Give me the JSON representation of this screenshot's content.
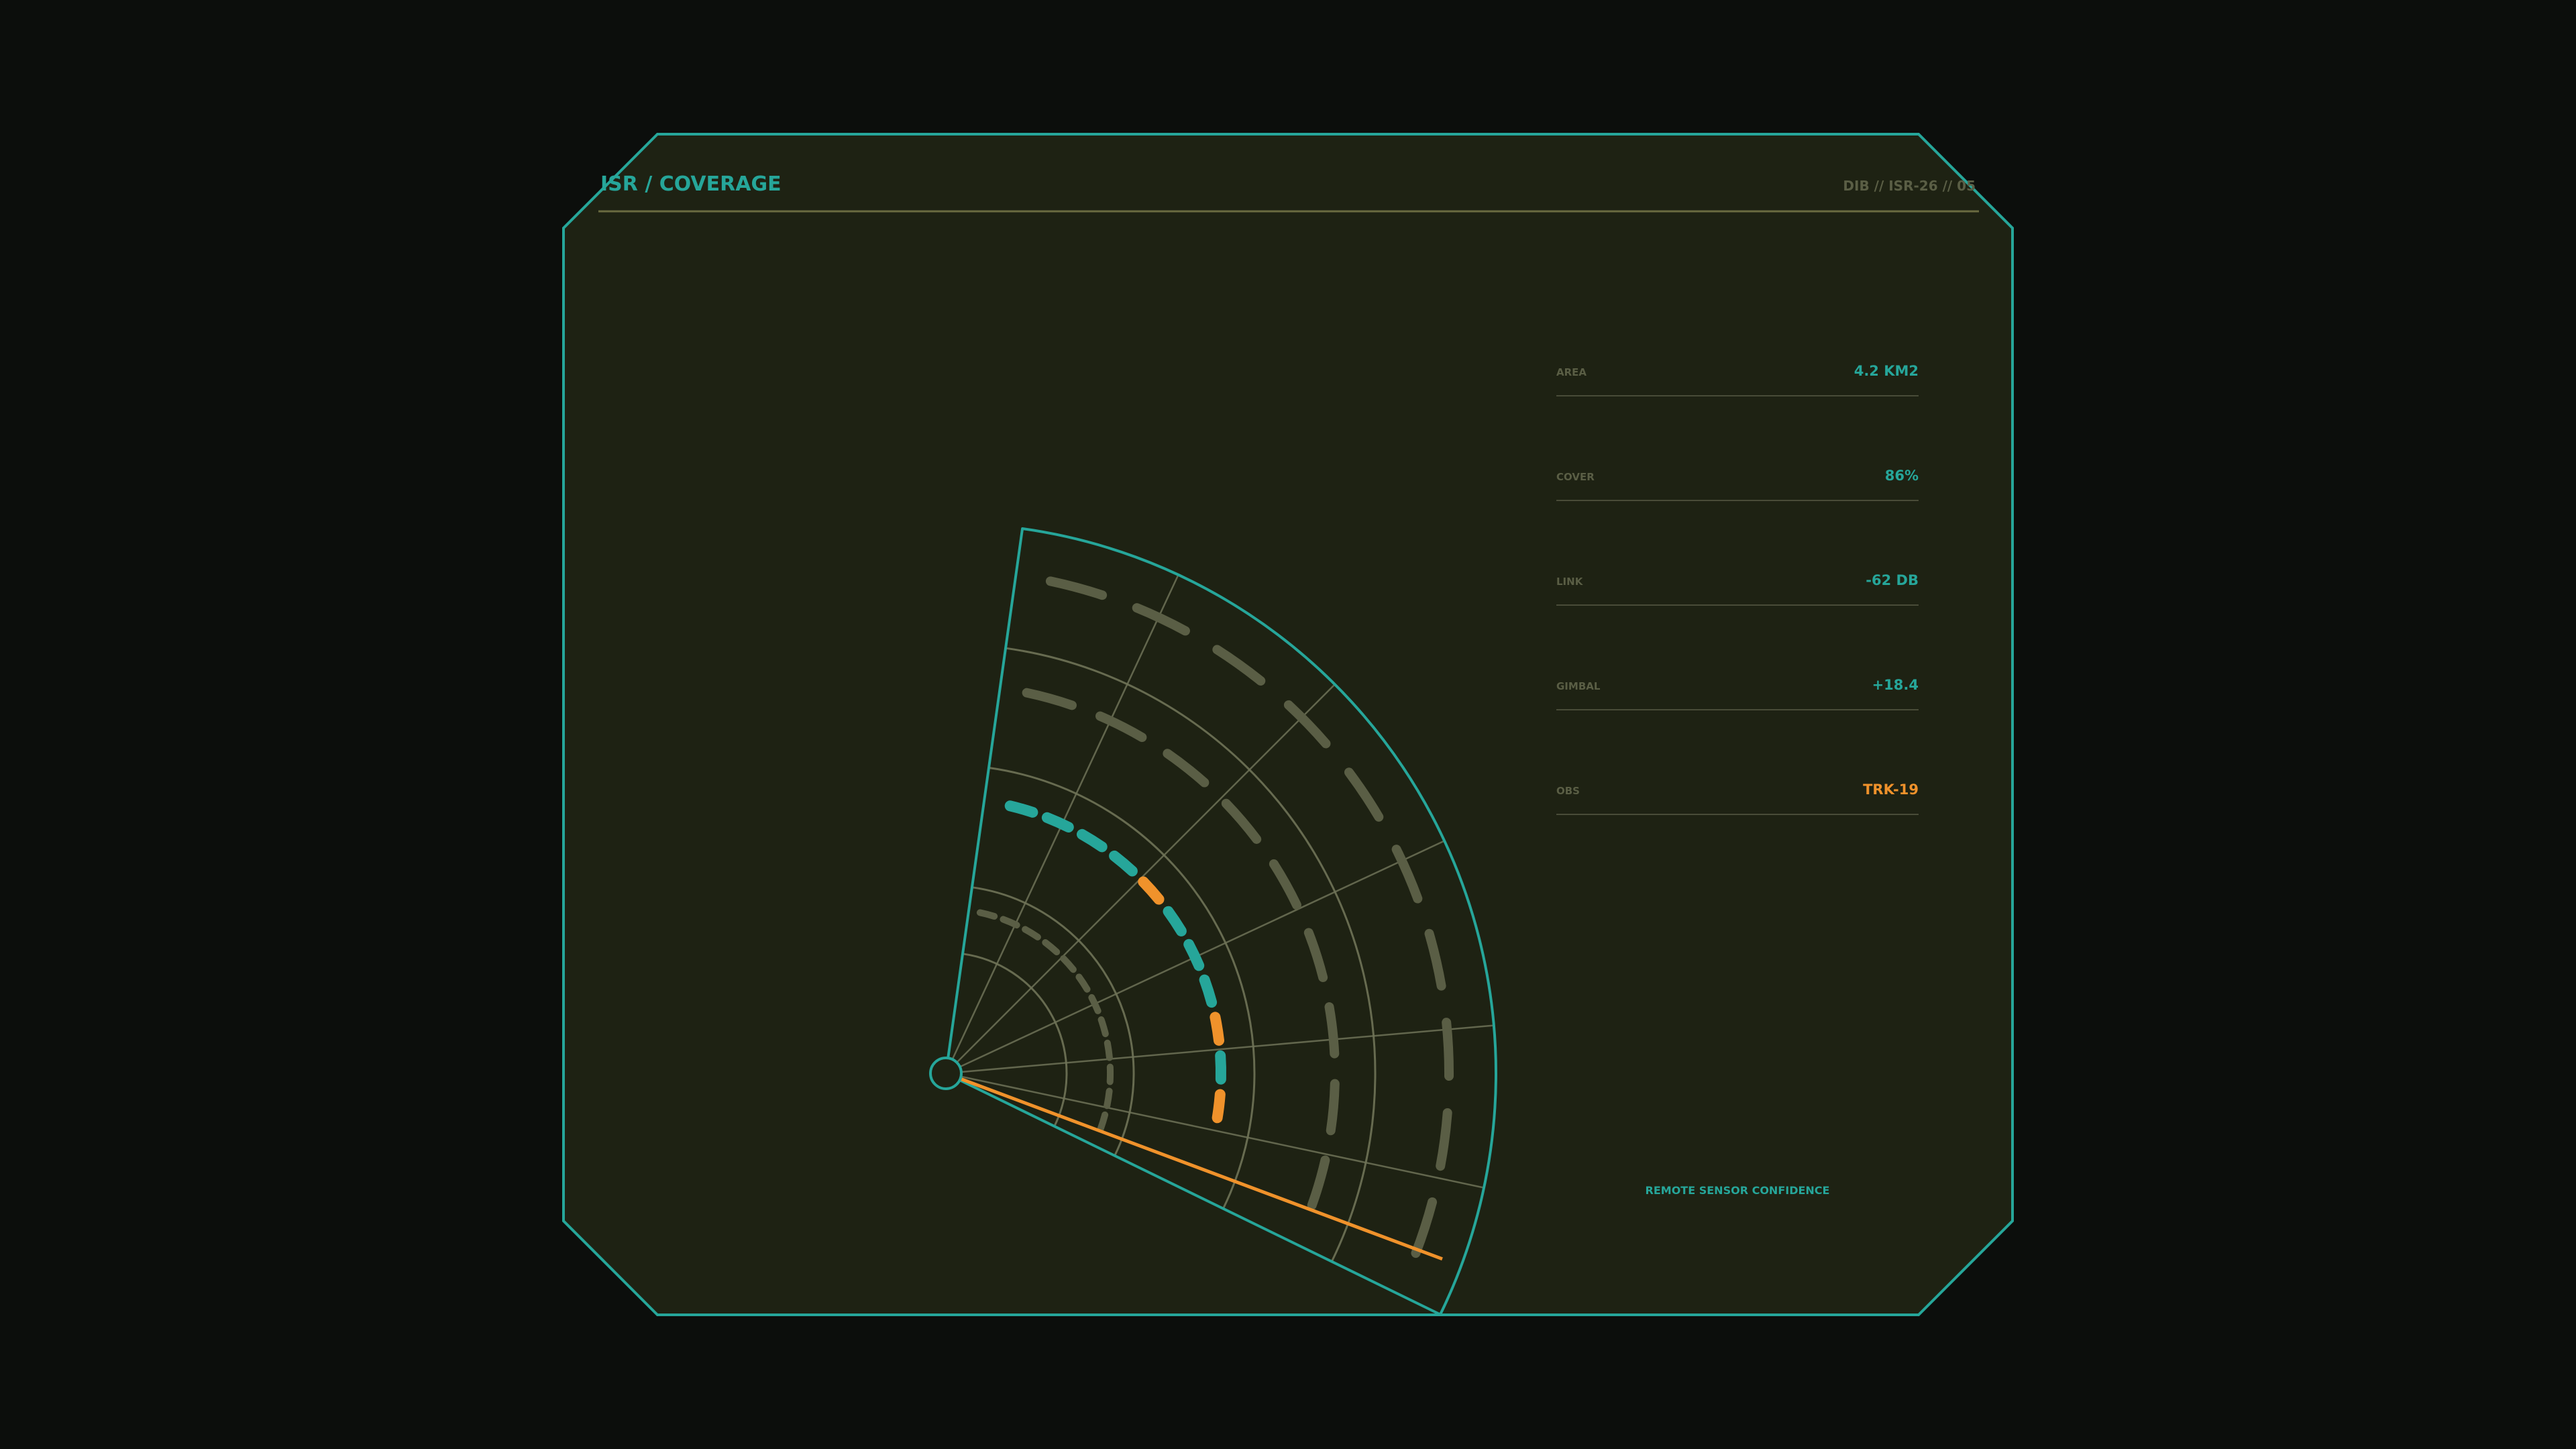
{
  "panel": {
    "title": "ISR / COVERAGE",
    "id_code": "DIB // ISR-26 // 05",
    "footer_label": "REMOTE SENSOR CONFIDENCE"
  },
  "readouts": [
    {
      "label": "AREA",
      "value": "4.2 KM2",
      "state": "normal"
    },
    {
      "label": "COVER",
      "value": "86%",
      "state": "normal"
    },
    {
      "label": "LINK",
      "value": "-62 DB",
      "state": "normal"
    },
    {
      "label": "GIMBAL",
      "value": "+18.4",
      "state": "normal"
    },
    {
      "label": "OBS",
      "value": "TRK-19",
      "state": "alert"
    }
  ],
  "colors": {
    "background": "#0c0e0c",
    "panel_fill": "#1e2213",
    "accent": "#26a69a",
    "alert": "#f0922b",
    "muted": "#5a5e45",
    "grid": "#6f7358"
  },
  "sensor_fan": {
    "sector_start_deg": -82,
    "sector_end_deg": 26,
    "rings": 5,
    "spokes_deg": [
      -65,
      -45,
      -25,
      -5,
      12
    ],
    "heading_deg": 20.5,
    "active_ring": 2,
    "alert_segments_on_active_ring": [
      4,
      8
    ]
  }
}
